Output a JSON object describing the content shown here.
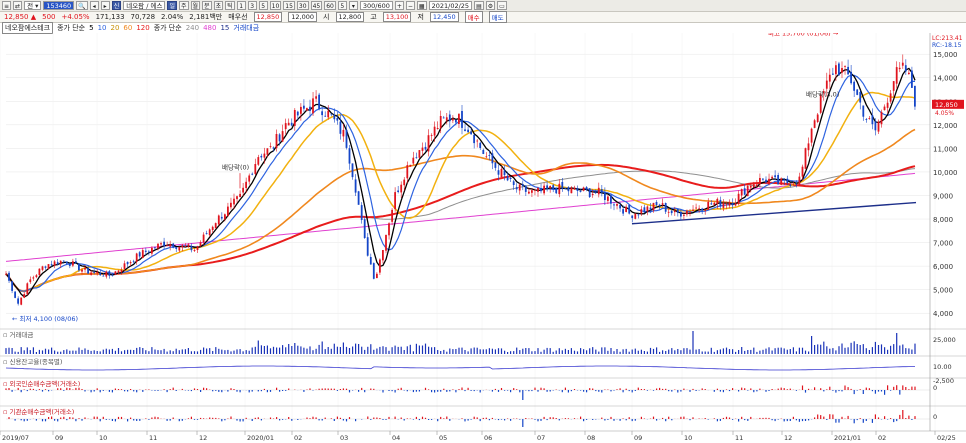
{
  "toolbar": {
    "code": "153460",
    "stock_name": "네오팜 / 에스",
    "buttons": [
      "일",
      "주",
      "월",
      "분",
      "초",
      "틱"
    ],
    "intervals": [
      "1",
      "3",
      "5",
      "10",
      "15",
      "30",
      "45",
      "60",
      "5"
    ],
    "count": "300/600",
    "date": "2021/02/25"
  },
  "price_bar": {
    "price": "12,850 ▲",
    "change": "500",
    "pct": "+4.05%",
    "volume": "171,133",
    "amount": "70,728",
    "ratio": "2.04%",
    "amount_label": "2,181백만",
    "priority_label": "매우선",
    "priority": "12,850",
    "open_val": "12,000",
    "high_label": "시",
    "high_val": "12,800",
    "low_label": "고",
    "low_val": "13,100",
    "close_label": "저",
    "close_val": "12,450",
    "buy_label": "매수",
    "sell_label": "매도"
  },
  "legend": {
    "name": "네오팜에스테크",
    "ma_label": "종가 단순",
    "ma_periods": [
      "5",
      "10",
      "20",
      "60",
      "120"
    ],
    "ma2_label": "종가 단순",
    "ma2_periods": [
      "240",
      "480",
      "15"
    ],
    "volume_label": "거래대금"
  },
  "colors": {
    "up": "#e0141e",
    "down": "#1546c8",
    "ma5": "#000000",
    "ma10": "#2e63e0",
    "ma20": "#f2b10f",
    "ma60": "#f0881e",
    "ma120": "#e81c1c",
    "ma240": "#8f8f8f",
    "ma480": "#e040d0",
    "trend": "#1d2f8a"
  },
  "chart_data": {
    "type": "candlestick",
    "x": [
      "2019/07",
      "09",
      "10",
      "11",
      "12",
      "2020/01",
      "02",
      "03",
      "04",
      "05",
      "06",
      "07",
      "08",
      "09",
      "10",
      "11",
      "12",
      "2021/01",
      "02",
      "02/25"
    ],
    "price_ticks": [
      "15,000",
      "14,000",
      "13,000",
      "12,000",
      "11,000",
      "10,000",
      "9,000",
      "8,000",
      "7,000",
      "6,000",
      "5,000",
      "4,000"
    ],
    "ylim": [
      3500,
      15900
    ],
    "annotations": {
      "low": "최저 4,100 (08/06)",
      "high": "최고 15,700 (01/06)",
      "div1": "배당락(0)",
      "div2": "배당락(3,0)",
      "current_price": "12,850",
      "current_pct": "4.05%",
      "lc": "LC:213.41",
      "rc": "RC:-18.15"
    },
    "panels": [
      {
        "name": "거래대금",
        "ticks": [
          "25,000"
        ]
      },
      {
        "name": "신용잔고율(종목별)",
        "ticks": [
          "10.00"
        ]
      },
      {
        "name": "외국인순매수금액(거래소)",
        "ticks": [
          "0",
          "-2,500"
        ]
      },
      {
        "name": "기관순매수금액(거래소)",
        "ticks": [
          "0"
        ]
      }
    ],
    "close_keypoints": [
      [
        0,
        6300
      ],
      [
        12,
        5050
      ],
      [
        18,
        4400
      ],
      [
        30,
        5400
      ],
      [
        45,
        6050
      ],
      [
        65,
        6250
      ],
      [
        85,
        5800
      ],
      [
        110,
        5600
      ],
      [
        140,
        6500
      ],
      [
        165,
        7000
      ],
      [
        195,
        6700
      ],
      [
        215,
        7900
      ],
      [
        240,
        8900
      ],
      [
        258,
        10700
      ],
      [
        272,
        11000
      ],
      [
        285,
        12000
      ],
      [
        300,
        12500
      ],
      [
        315,
        13000
      ],
      [
        330,
        12400
      ],
      [
        345,
        11500
      ],
      [
        355,
        9500
      ],
      [
        365,
        7000
      ],
      [
        375,
        5400
      ],
      [
        385,
        7200
      ],
      [
        395,
        9000
      ],
      [
        410,
        10500
      ],
      [
        425,
        11200
      ],
      [
        440,
        12100
      ],
      [
        455,
        12400
      ],
      [
        470,
        11800
      ],
      [
        485,
        10700
      ],
      [
        500,
        10000
      ],
      [
        515,
        9300
      ],
      [
        535,
        9100
      ],
      [
        555,
        9300
      ],
      [
        575,
        9200
      ],
      [
        600,
        9100
      ],
      [
        618,
        8600
      ],
      [
        630,
        8200
      ],
      [
        645,
        8400
      ],
      [
        660,
        8600
      ],
      [
        675,
        8200
      ],
      [
        690,
        8400
      ],
      [
        705,
        8600
      ],
      [
        720,
        8700
      ],
      [
        735,
        8800
      ],
      [
        750,
        9500
      ],
      [
        765,
        9700
      ],
      [
        780,
        9500
      ],
      [
        800,
        9700
      ],
      [
        812,
        12000
      ],
      [
        825,
        13500
      ],
      [
        835,
        14500
      ],
      [
        850,
        14000
      ],
      [
        865,
        12400
      ],
      [
        875,
        11700
      ],
      [
        885,
        12900
      ],
      [
        895,
        14100
      ],
      [
        905,
        14400
      ],
      [
        912,
        13600
      ],
      [
        916,
        12850
      ]
    ]
  }
}
